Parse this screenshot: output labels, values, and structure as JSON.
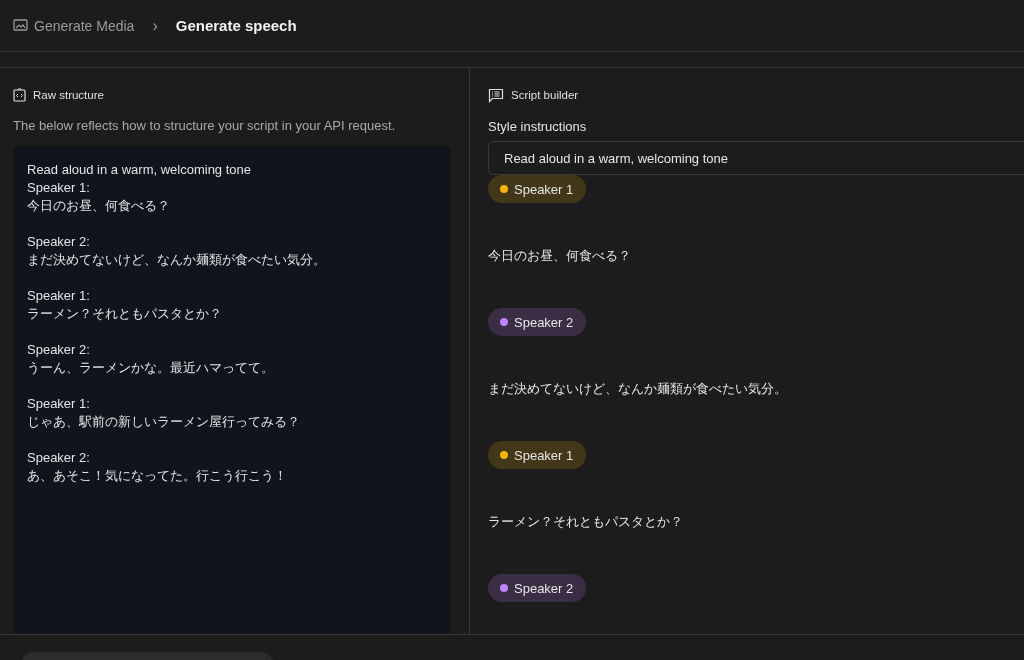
{
  "breadcrumb": {
    "parent": "Generate Media",
    "separator": "›",
    "current": "Generate speech"
  },
  "raw_structure": {
    "title": "Raw structure",
    "description": "The below reflects how to structure your script in your API request.",
    "instruction_line": "Read aloud in a warm, welcoming tone",
    "turns": [
      {
        "speaker": "Speaker 1:",
        "text": "今日のお昼、何食べる？"
      },
      {
        "speaker": "Speaker 2:",
        "text": "まだ決めてないけど、なんか麺類が食べたい気分。"
      },
      {
        "speaker": "Speaker 1:",
        "text": "ラーメン？それともパスタとか？"
      },
      {
        "speaker": "Speaker 2:",
        "text": "うーん、ラーメンかな。最近ハマってて。"
      },
      {
        "speaker": "Speaker 1:",
        "text": "じゃあ、駅前の新しいラーメン屋行ってみる？"
      },
      {
        "speaker": "Speaker 2:",
        "text": "あ、あそこ！気になってた。行こう行こう！"
      }
    ]
  },
  "script_builder": {
    "title": "Script builder",
    "style_label": "Style instructions",
    "style_value": "Read aloud in a warm, welcoming tone",
    "turns": [
      {
        "speaker": "Speaker 1",
        "color": "#f5b50a",
        "text": "今日のお昼、何食べる？"
      },
      {
        "speaker": "Speaker 2",
        "color": "#c084fc",
        "text": "まだ決めてないけど、なんか麺類が食べたい気分。"
      },
      {
        "speaker": "Speaker 1",
        "color": "#f5b50a",
        "text": "ラーメン？それともパスタとか？"
      },
      {
        "speaker": "Speaker 2",
        "color": "#c084fc"
      }
    ]
  }
}
